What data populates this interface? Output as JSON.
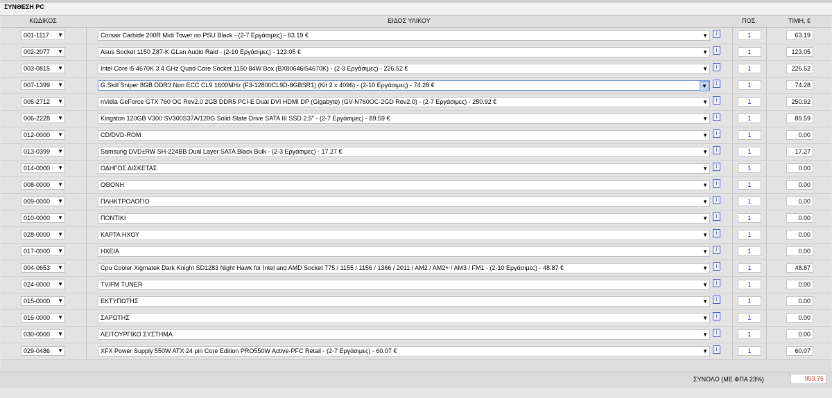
{
  "section_title": "ΣΥΝΘΕΣΗ PC",
  "columns": {
    "code": "ΚΩΔΙΚΟΣ",
    "item": "ΕΙΔΟΣ ΥΛΙΚΟΥ",
    "qty": "ΠΟΣ.",
    "price": "ΤΙΜΗ, €"
  },
  "info_label": "i",
  "dropdown_arrow": "▼",
  "rows": [
    {
      "code": "001-1117",
      "item": "Corsair Carbide 200R Midi Tower no PSU Black - (2-7 Εργάσιμες) - 63.19 €",
      "qty": "1",
      "price": "63.19"
    },
    {
      "code": "002-2077",
      "item": "Asus Socket 1150 Z87-K GLan Audio Raid - (2-10 Εργάσιμες) - 123.05 €",
      "qty": "1",
      "price": "123.05"
    },
    {
      "code": "003-0815",
      "item": "Intel Core i5 4670K 3.4 GHz Quad Core Socket 1150 84W Box (BX80646I54670K) - (2-3 Εργάσιμες) - 226.52 €",
      "qty": "1",
      "price": "226.52"
    },
    {
      "code": "007-1399",
      "item": "G.Skill Sniper 8GB DDR3 Non ECC CL9 1600MHz (F3-12800CL9D-8GBSR1) (Kit 2 x 4096) - (2-10 Εργάσιμες) - 74.28 €",
      "qty": "1",
      "price": "74.28",
      "focused": true
    },
    {
      "code": "005-2712",
      "item": "nVidia GeForce GTX 760 OC Rev2.0 2GB DDR5 PCI-E Dual DVI HDMI DP (Gigabyte) (GV-N760OC-2GD Rev2.0) - (2-7 Εργάσιμες) - 250.92 €",
      "qty": "1",
      "price": "250.92"
    },
    {
      "code": "006-2228",
      "item": "Kingston 120GB V300 SV300S37A/120G Solid State Drive SATA III SSD 2.5\" - (2-7 Εργάσιμες) - 89.59 €",
      "qty": "1",
      "price": "89.59"
    },
    {
      "code": "012-0000",
      "item": "CD/DVD-ROM",
      "qty": "1",
      "price": "0.00"
    },
    {
      "code": "013-0399",
      "item": "Samsung DVD±RW SH-224BB Dual Layer SATA Black Bulk - (2-3 Εργάσιμες) - 17.27 €",
      "qty": "1",
      "price": "17.27"
    },
    {
      "code": "014-0000",
      "item": "ΟΔΗΓΟΣ ΔΙΣΚΕΤΑΣ",
      "qty": "1",
      "price": "0.00"
    },
    {
      "code": "008-0000",
      "item": "ΟΘΟΝΗ",
      "qty": "1",
      "price": "0.00"
    },
    {
      "code": "009-0000",
      "item": "ΠΛΗΚΤΡΟΛΟΓΙΟ",
      "qty": "1",
      "price": "0.00"
    },
    {
      "code": "010-0000",
      "item": "ΠΟΝΤΙΚΙ",
      "qty": "1",
      "price": "0.00"
    },
    {
      "code": "028-0000",
      "item": "ΚΑΡΤΑ ΗΧΟΥ",
      "qty": "1",
      "price": "0.00"
    },
    {
      "code": "017-0000",
      "item": "ΗΧΕΙΑ",
      "qty": "1",
      "price": "0.00"
    },
    {
      "code": "004-0653",
      "item": "Cpu Cooler Xigmatek Dark Knight SD1283 Night Hawk for Intel and AMD Socket 775 / 1155 / 1156 / 1366 / 2011 / AM2 / AM2+ / AM3 / FM1 - (2-10 Εργάσιμες) - 48.87 €",
      "qty": "1",
      "price": "48.87"
    },
    {
      "code": "024-0000",
      "item": "TV/FM TUNER",
      "qty": "1",
      "price": "0.00"
    },
    {
      "code": "015-0000",
      "item": "ΕΚΤΥΠΩΤΗΣ",
      "qty": "1",
      "price": "0.00"
    },
    {
      "code": "016-0000",
      "item": "ΣΑΡΩΤΗΣ",
      "qty": "1",
      "price": "0.00"
    },
    {
      "code": "030-0000",
      "item": "ΛΕΙΤΟΥΡΓΙΚΟ ΣΥΣΤΗΜΑ",
      "qty": "1",
      "price": "0.00"
    },
    {
      "code": "029-0486",
      "item": "XFX Power Supply 550W ATX 24 pin Core Edition PRO550W Active-PFC Retail - (2-7 Εργάσιμες) - 60.07 €",
      "qty": "1",
      "price": "60.07"
    }
  ],
  "total": {
    "label": "ΣΥΝΟΛΟ (ΜΕ ΦΠΑ 23%)",
    "value": "953.76",
    "color": "#c0392b"
  }
}
